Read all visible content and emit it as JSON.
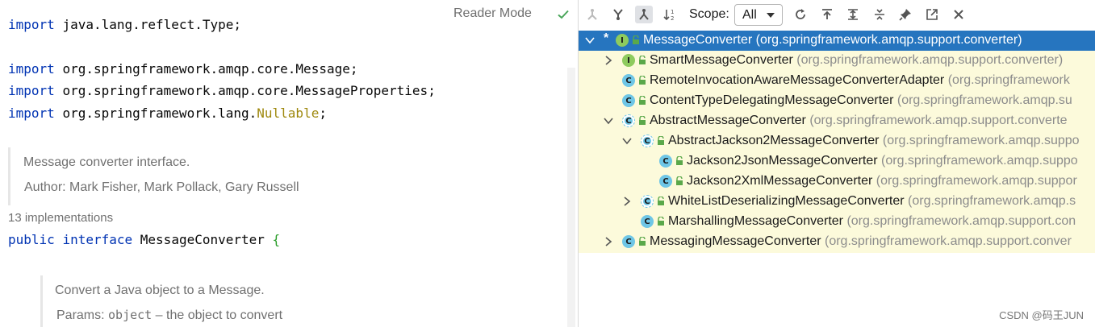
{
  "editor": {
    "reader_mode": "Reader Mode",
    "imports": [
      {
        "keyword": "import",
        "path": "java.lang.reflect.Type",
        "end": ";"
      },
      {
        "keyword": "import",
        "path": "org.springframework.amqp.core.Message",
        "end": ";"
      },
      {
        "keyword": "import",
        "path": "org.springframework.amqp.core.MessageProperties",
        "end": ";"
      },
      {
        "keyword": "import",
        "path": "org.springframework.lang.",
        "annotation": "Nullable",
        "end": ";"
      }
    ],
    "class_doc": {
      "description": "Message converter interface.",
      "author_label": "Author:",
      "authors": "Mark Fisher, Mark Pollack, Gary Russell"
    },
    "implementations": "13 implementations",
    "declaration": {
      "kw1": "public",
      "kw2": "interface",
      "name": "MessageConverter",
      "brace": "{"
    },
    "method_doc": {
      "description": "Convert a Java object to a Message.",
      "params_label": "Params:",
      "param_name": "object",
      "param_desc": "– the object to convert"
    }
  },
  "hierarchy": {
    "scope_label": "Scope:",
    "scope_value": "All",
    "toolbar_icons": [
      "supertypes-icon",
      "subtypes-icon",
      "type-hierarchy-icon",
      "sort-alpha-icon",
      "refresh-icon",
      "export-icon",
      "expand-all-icon",
      "collapse-all-icon",
      "pin-icon",
      "open-in-window-icon",
      "close-icon"
    ],
    "rows": [
      {
        "name": "MessageConverter",
        "pkg": "(org.springframework.amqp.support.converter)",
        "kind": "I",
        "expanded": true,
        "star": true,
        "selected": true
      },
      {
        "name": "SmartMessageConverter",
        "pkg": "(org.springframework.amqp.support.converter)",
        "kind": "I",
        "expanded": false
      },
      {
        "name": "RemoteInvocationAwareMessageConverterAdapter",
        "pkg": "(org.springframework",
        "kind": "C"
      },
      {
        "name": "ContentTypeDelegatingMessageConverter",
        "pkg": "(org.springframework.amqp.su",
        "kind": "C"
      },
      {
        "name": "AbstractMessageConverter",
        "pkg": "(org.springframework.amqp.support.converte",
        "kind": "A",
        "expanded": true
      },
      {
        "name": "AbstractJackson2MessageConverter",
        "pkg": "(org.springframework.amqp.suppo",
        "kind": "A",
        "expanded": true
      },
      {
        "name": "Jackson2JsonMessageConverter",
        "pkg": "(org.springframework.amqp.suppo",
        "kind": "C"
      },
      {
        "name": "Jackson2XmlMessageConverter",
        "pkg": "(org.springframework.amqp.suppor",
        "kind": "C"
      },
      {
        "name": "WhiteListDeserializingMessageConverter",
        "pkg": "(org.springframework.amqp.s",
        "kind": "A",
        "expanded": false
      },
      {
        "name": "MarshallingMessageConverter",
        "pkg": "(org.springframework.amqp.support.con",
        "kind": "C"
      },
      {
        "name": "MessagingMessageConverter",
        "pkg": "(org.springframework.amqp.support.conver",
        "kind": "C",
        "expanded": false
      }
    ]
  },
  "watermark": "CSDN @码王JUN"
}
